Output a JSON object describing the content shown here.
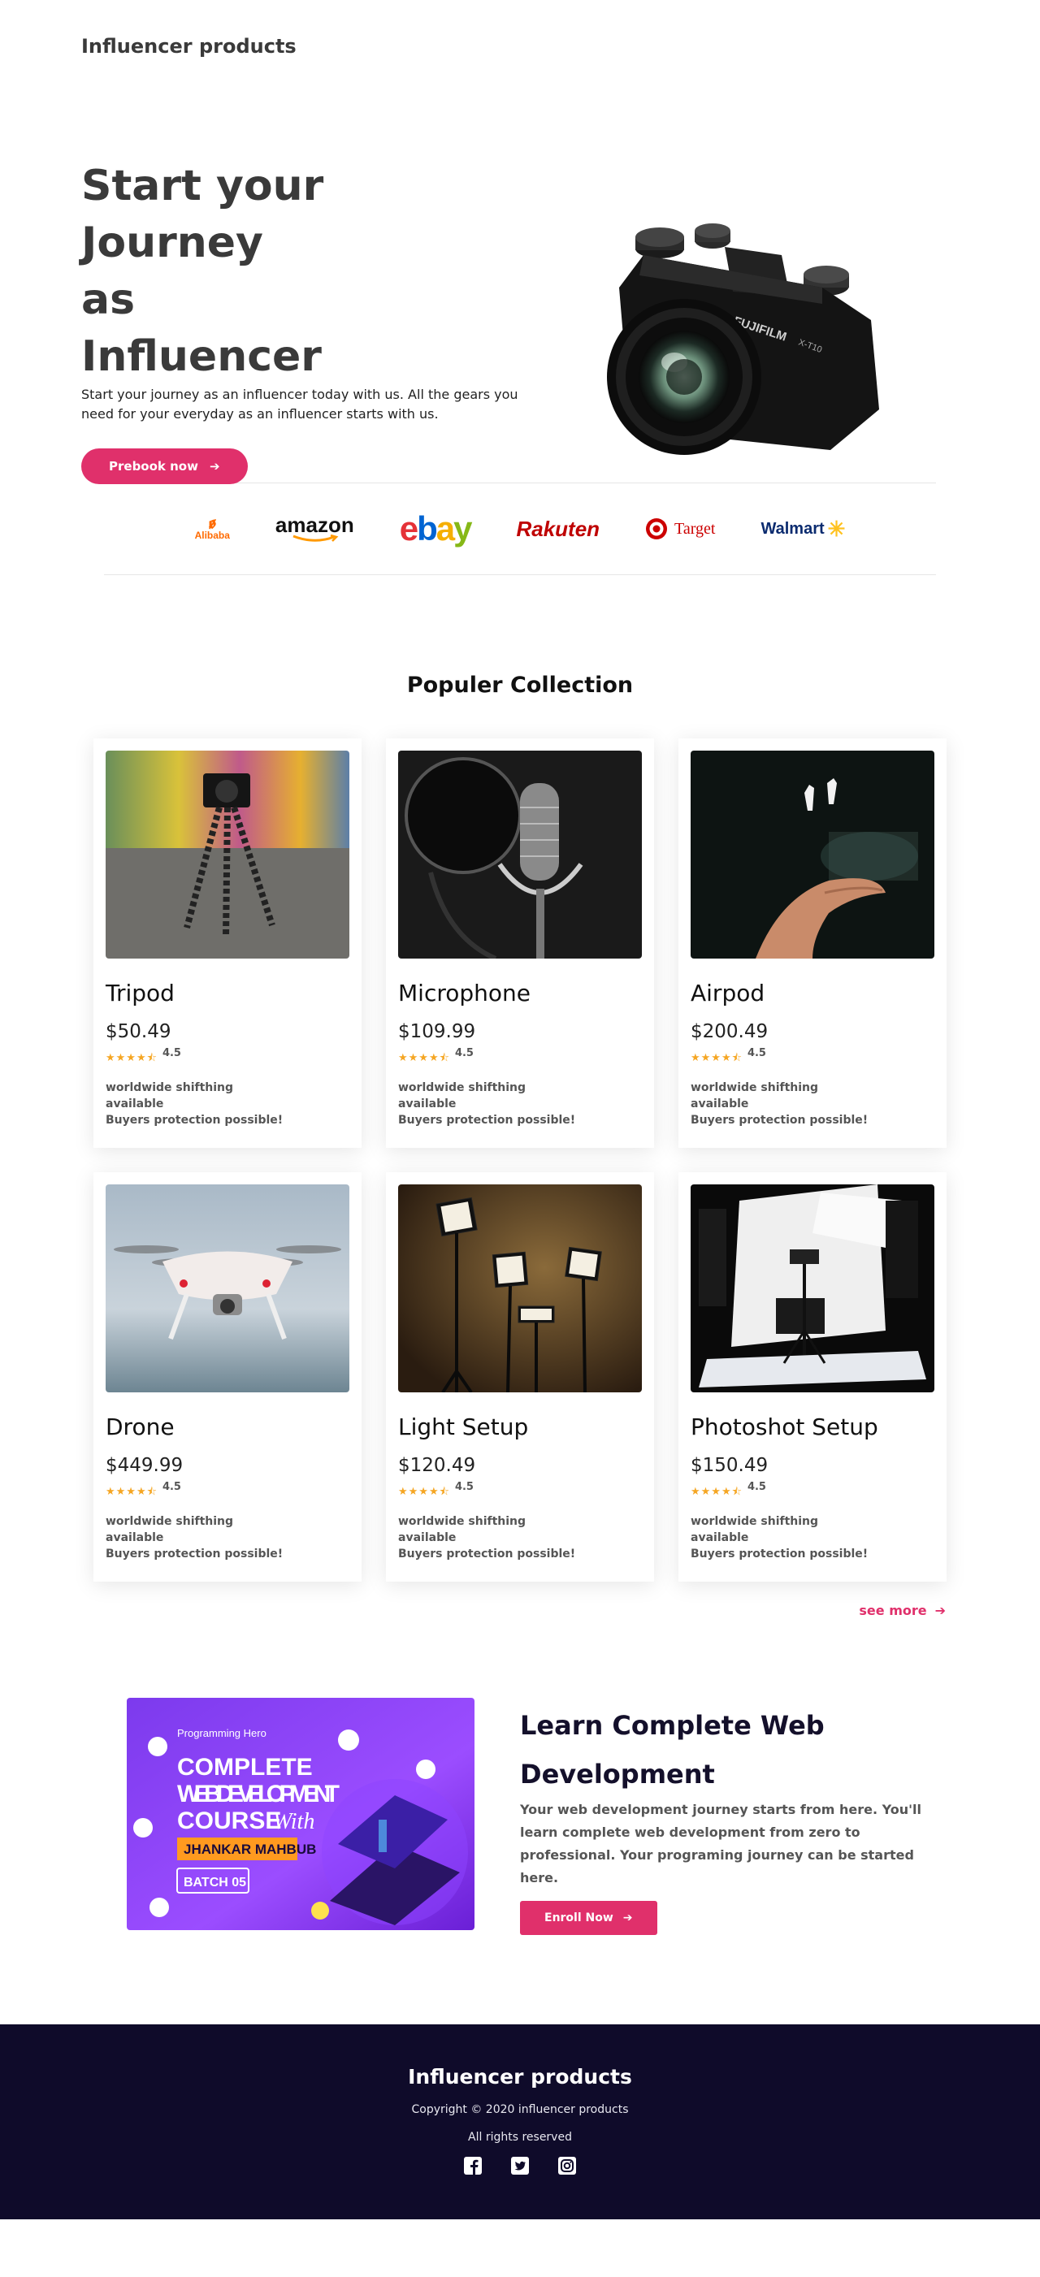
{
  "header": {
    "brand": "Influencer products"
  },
  "hero": {
    "title_line1": "Start your Journey",
    "title_line2": "as",
    "title_line3": "Influencer",
    "description": "Start your journey as an influencer today with us. All the gears you need for your everyday as an influencer starts with us.",
    "cta_label": "Prebook now",
    "camera_brand": "FUJIFILM",
    "camera_model": "X-T10"
  },
  "brands": [
    {
      "name": "Alibaba",
      "icon": "alibaba-logo"
    },
    {
      "name": "amazon",
      "icon": "amazon-logo"
    },
    {
      "name": "ebay",
      "icon": "ebay-logo"
    },
    {
      "name": "Rakuten",
      "icon": "rakuten-logo"
    },
    {
      "name": "Target",
      "icon": "target-logo"
    },
    {
      "name": "Walmart",
      "icon": "walmart-logo"
    }
  ],
  "collection": {
    "title": "Populer Collection",
    "see_more": "see more",
    "products": [
      {
        "name": "Tripod",
        "price": "$50.49",
        "rating": "4.5",
        "shipping": "worldwide shifthing available",
        "protection": "Buyers protection possible!"
      },
      {
        "name": "Microphone",
        "price": "$109.99",
        "rating": "4.5",
        "shipping": "worldwide shifthing available",
        "protection": "Buyers protection possible!"
      },
      {
        "name": "Airpod",
        "price": "$200.49",
        "rating": "4.5",
        "shipping": "worldwide shifthing available",
        "protection": "Buyers protection possible!"
      },
      {
        "name": "Drone",
        "price": "$449.99",
        "rating": "4.5",
        "shipping": "worldwide shifthing available",
        "protection": "Buyers protection possible!"
      },
      {
        "name": "Light Setup",
        "price": "$120.49",
        "rating": "4.5",
        "shipping": "worldwide shifthing available",
        "protection": "Buyers protection possible!"
      },
      {
        "name": "Photoshot Setup",
        "price": "$150.49",
        "rating": "4.5",
        "shipping": "worldwide shifthing available",
        "protection": "Buyers protection possible!"
      }
    ]
  },
  "course": {
    "banner": {
      "org": "Programming Hero",
      "line1": "COMPLETE",
      "line2": "WEB DEVELOPMENT",
      "line3": "COURSE",
      "with": "With",
      "instructor": "JHANKAR MAHBUB",
      "batch": "BATCH 05"
    },
    "title": "Learn Complete Web Development",
    "description": "Your web development journey starts from here. You'll learn complete web development from zero to professional. Your programing journey can be started here.",
    "cta_label": "Enroll Now"
  },
  "footer": {
    "brand": "Influencer products",
    "copyright": "Copyright © 2020 influencer products",
    "rights": "All rights reserved",
    "socials": [
      "facebook-icon",
      "twitter-icon",
      "instagram-icon"
    ]
  },
  "colors": {
    "accent": "#e0306b",
    "footer_bg": "#0f0b2a",
    "star": "#f5a623"
  }
}
